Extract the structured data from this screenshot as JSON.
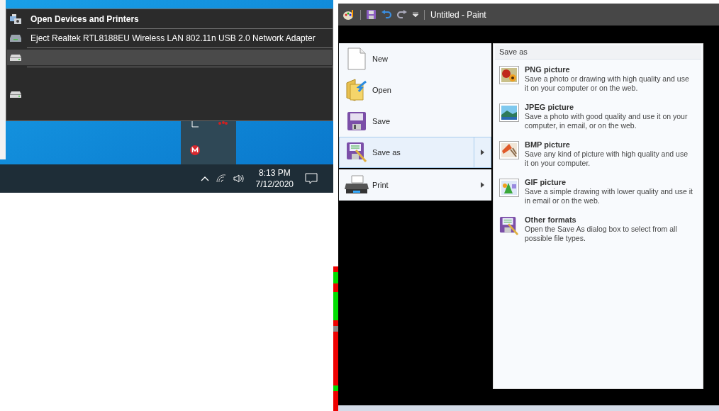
{
  "devices_popup": {
    "items": [
      {
        "kind": "devices",
        "label": "Open Devices and Printers",
        "highlighted": false
      },
      {
        "kind": "adapter",
        "label": "Eject Realtek RTL8188EU Wireless LAN 802.11n USB 2.0 Network Adapter",
        "highlighted": false
      },
      {
        "kind": "drive",
        "highlighted": true
      },
      {
        "kind": "drive",
        "highlighted": false
      }
    ]
  },
  "taskbar": {
    "time": "8:13 PM",
    "date": "7/12/2020"
  },
  "paint": {
    "title": "Untitled - Paint",
    "menu": [
      {
        "kind": "new",
        "label": "New",
        "selected": false,
        "submenu": false
      },
      {
        "kind": "open",
        "label": "Open",
        "selected": false,
        "submenu": false
      },
      {
        "kind": "save",
        "label": "Save",
        "selected": false,
        "submenu": false
      },
      {
        "kind": "saveas",
        "label": "Save as",
        "selected": true,
        "submenu": true
      },
      {
        "kind": "print",
        "label": "Print",
        "selected": false,
        "submenu": true
      }
    ],
    "submenu": {
      "heading": "Save as",
      "options": [
        {
          "kind": "png",
          "title": "PNG picture",
          "description": "Save a photo or drawing with high quality and use it on your computer or on the web."
        },
        {
          "kind": "jpeg",
          "title": "JPEG picture",
          "description": "Save a photo with good quality and use it on your computer, in email, or on the web."
        },
        {
          "kind": "bmp",
          "title": "BMP picture",
          "description": "Save any kind of picture with high quality and use it on your computer."
        },
        {
          "kind": "gif",
          "title": "GIF picture",
          "description": "Save a simple drawing with lower quality and use it in email or on the web."
        },
        {
          "kind": "other",
          "title": "Other formats",
          "description": "Open the Save As dialog box to select from all possible file types."
        }
      ]
    }
  }
}
